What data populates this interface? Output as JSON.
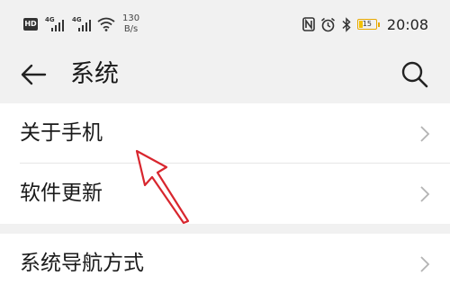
{
  "status_bar": {
    "hd_label": "HD",
    "network_1": "4G",
    "network_2": "4G",
    "speed_value": "130",
    "speed_unit": "B/s",
    "battery_level": "15",
    "time": "20:08",
    "icons": [
      "nfc-icon",
      "alarm-icon",
      "bluetooth-icon",
      "wifi-icon"
    ],
    "battery_color": "#f4c200"
  },
  "toolbar": {
    "title": "系统"
  },
  "settings": {
    "group1": [
      {
        "label": "关于手机"
      },
      {
        "label": "软件更新"
      }
    ],
    "group2": [
      {
        "label": "系统导航方式"
      }
    ]
  },
  "annotation": {
    "arrow_color": "#d8262e"
  }
}
